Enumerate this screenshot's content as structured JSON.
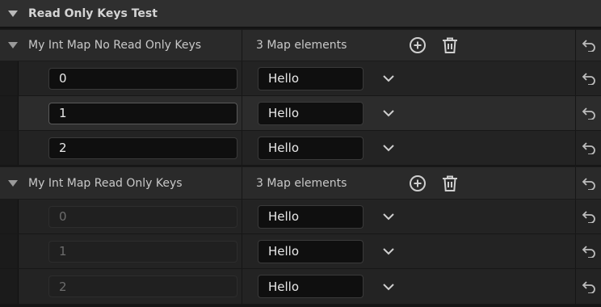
{
  "category": {
    "title": "Read Only Keys Test"
  },
  "maps": [
    {
      "label": "My Int Map No Read Only Keys",
      "count": "3 Map elements",
      "entries": [
        {
          "key": "0",
          "value": "Hello"
        },
        {
          "key": "1",
          "value": "Hello"
        },
        {
          "key": "2",
          "value": "Hello"
        }
      ]
    },
    {
      "label": "My Int Map Read Only Keys",
      "count": "3 Map elements",
      "entries": [
        {
          "key": "0",
          "value": "Hello"
        },
        {
          "key": "1",
          "value": "Hello"
        },
        {
          "key": "2",
          "value": "Hello"
        }
      ]
    }
  ],
  "icons": {
    "add": "plus-circle-icon",
    "remove": "trash-icon",
    "reset": "reset-arrow-icon",
    "combo": "chevron-down-icon"
  }
}
